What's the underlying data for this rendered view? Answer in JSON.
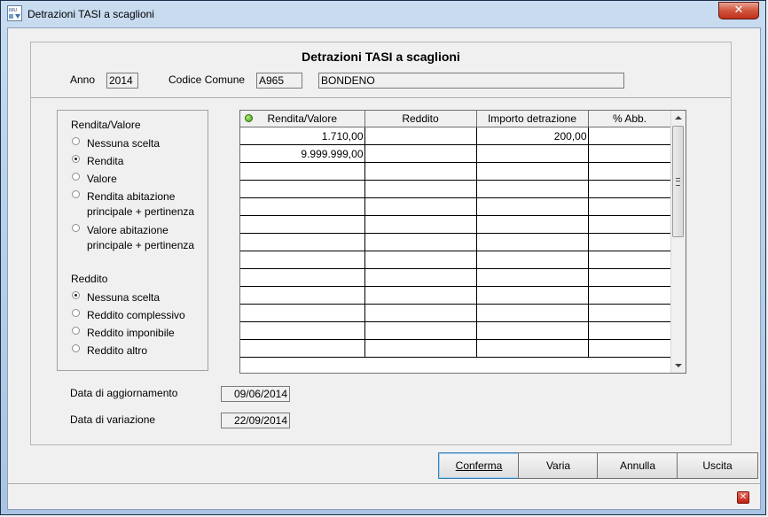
{
  "window": {
    "title": "Detrazioni TASI a scaglioni",
    "close_glyph": "✕",
    "app_icon": "imu-app-icon"
  },
  "header": {
    "title": "Detrazioni TASI a scaglioni",
    "anno_label": "Anno",
    "anno_value": "2014",
    "codice_label": "Codice Comune",
    "codice_value": "A965",
    "comune_name": "BONDENO"
  },
  "rendita_group": {
    "title": "Rendita/Valore",
    "options": [
      {
        "label": "Nessuna scelta",
        "checked": false
      },
      {
        "label": "Rendita",
        "checked": true
      },
      {
        "label": "Valore",
        "checked": false
      },
      {
        "label": "Rendita abitazione",
        "label2": "principale + pertinenza",
        "checked": false
      },
      {
        "label": "Valore abitazione",
        "label2": "principale + pertinenza",
        "checked": false
      }
    ]
  },
  "reddito_group": {
    "title": "Reddito",
    "options": [
      {
        "label": "Nessuna scelta",
        "checked": true
      },
      {
        "label": "Reddito complessivo",
        "checked": false
      },
      {
        "label": "Reddito imponibile",
        "checked": false
      },
      {
        "label": "Reddito altro",
        "checked": false
      }
    ]
  },
  "grid": {
    "columns": [
      "Rendita/Valore",
      "Reddito",
      "Importo detrazione",
      "% Abb."
    ],
    "rows": [
      [
        "1.710,00",
        "",
        "200,00",
        ""
      ],
      [
        "9.999.999,00",
        "",
        "",
        ""
      ],
      [
        "",
        "",
        "",
        ""
      ],
      [
        "",
        "",
        "",
        ""
      ],
      [
        "",
        "",
        "",
        ""
      ],
      [
        "",
        "",
        "",
        ""
      ],
      [
        "",
        "",
        "",
        ""
      ],
      [
        "",
        "",
        "",
        ""
      ],
      [
        "",
        "",
        "",
        ""
      ],
      [
        "",
        "",
        "",
        ""
      ],
      [
        "",
        "",
        "",
        ""
      ],
      [
        "",
        "",
        "",
        ""
      ],
      [
        "",
        "",
        "",
        ""
      ]
    ]
  },
  "dates": {
    "aggiornamento_label": "Data di aggiornamento",
    "aggiornamento_value": "09/06/2014",
    "variazione_label": "Data di variazione",
    "variazione_value": "22/09/2014"
  },
  "buttons": {
    "conferma": "Conferma",
    "varia": "Varia",
    "annulla": "Annulla",
    "uscita": "Uscita"
  },
  "status": {
    "close_glyph": "✕"
  },
  "colors": {
    "title_bar": "#b9d1ea",
    "close_red": "#c0301a",
    "dialog_bg": "#f0f0f0"
  }
}
